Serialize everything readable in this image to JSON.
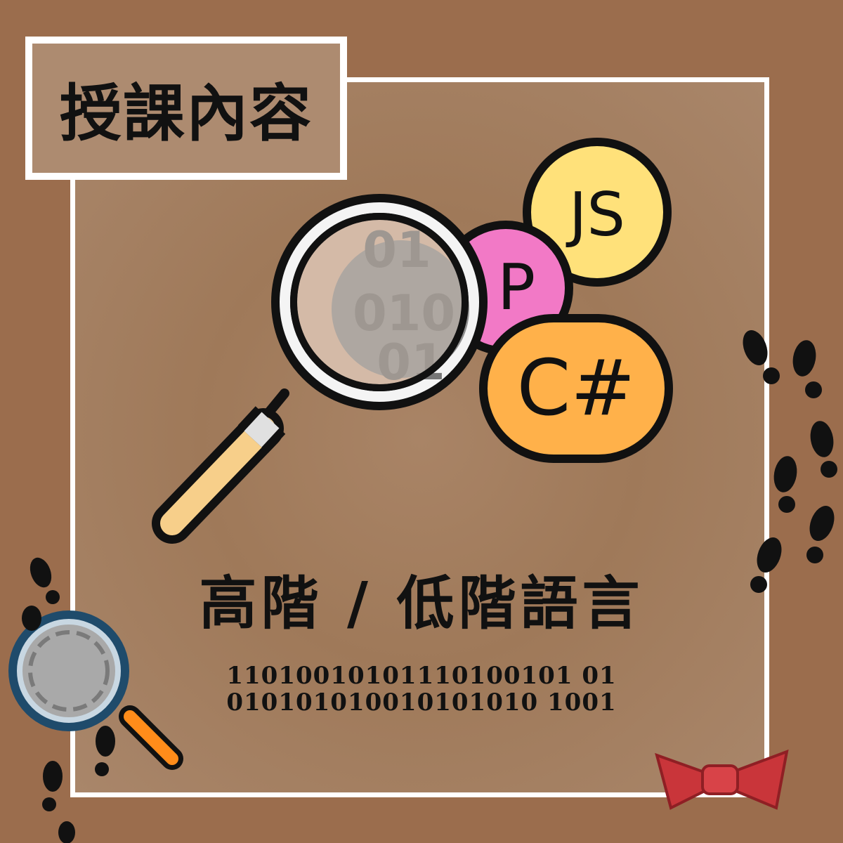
{
  "title": "授課內容",
  "heading": "高階 / 低階語言",
  "binary_lines": [
    "11010010101110100101 01",
    "010101010010101010 1001"
  ],
  "illustration": {
    "badges": [
      "JS",
      "P",
      "C#"
    ],
    "lens_text": [
      "01",
      "010",
      "01"
    ],
    "colors": {
      "js": "#ffe17a",
      "p": "#f279c6",
      "csharp": "#ffb14a",
      "handle": "#f7cf8a",
      "background": "#9b6d4d",
      "frame": "#ffffff"
    }
  },
  "decor": [
    "footprints-icon",
    "magnifier-icon",
    "bow-tie-icon"
  ]
}
